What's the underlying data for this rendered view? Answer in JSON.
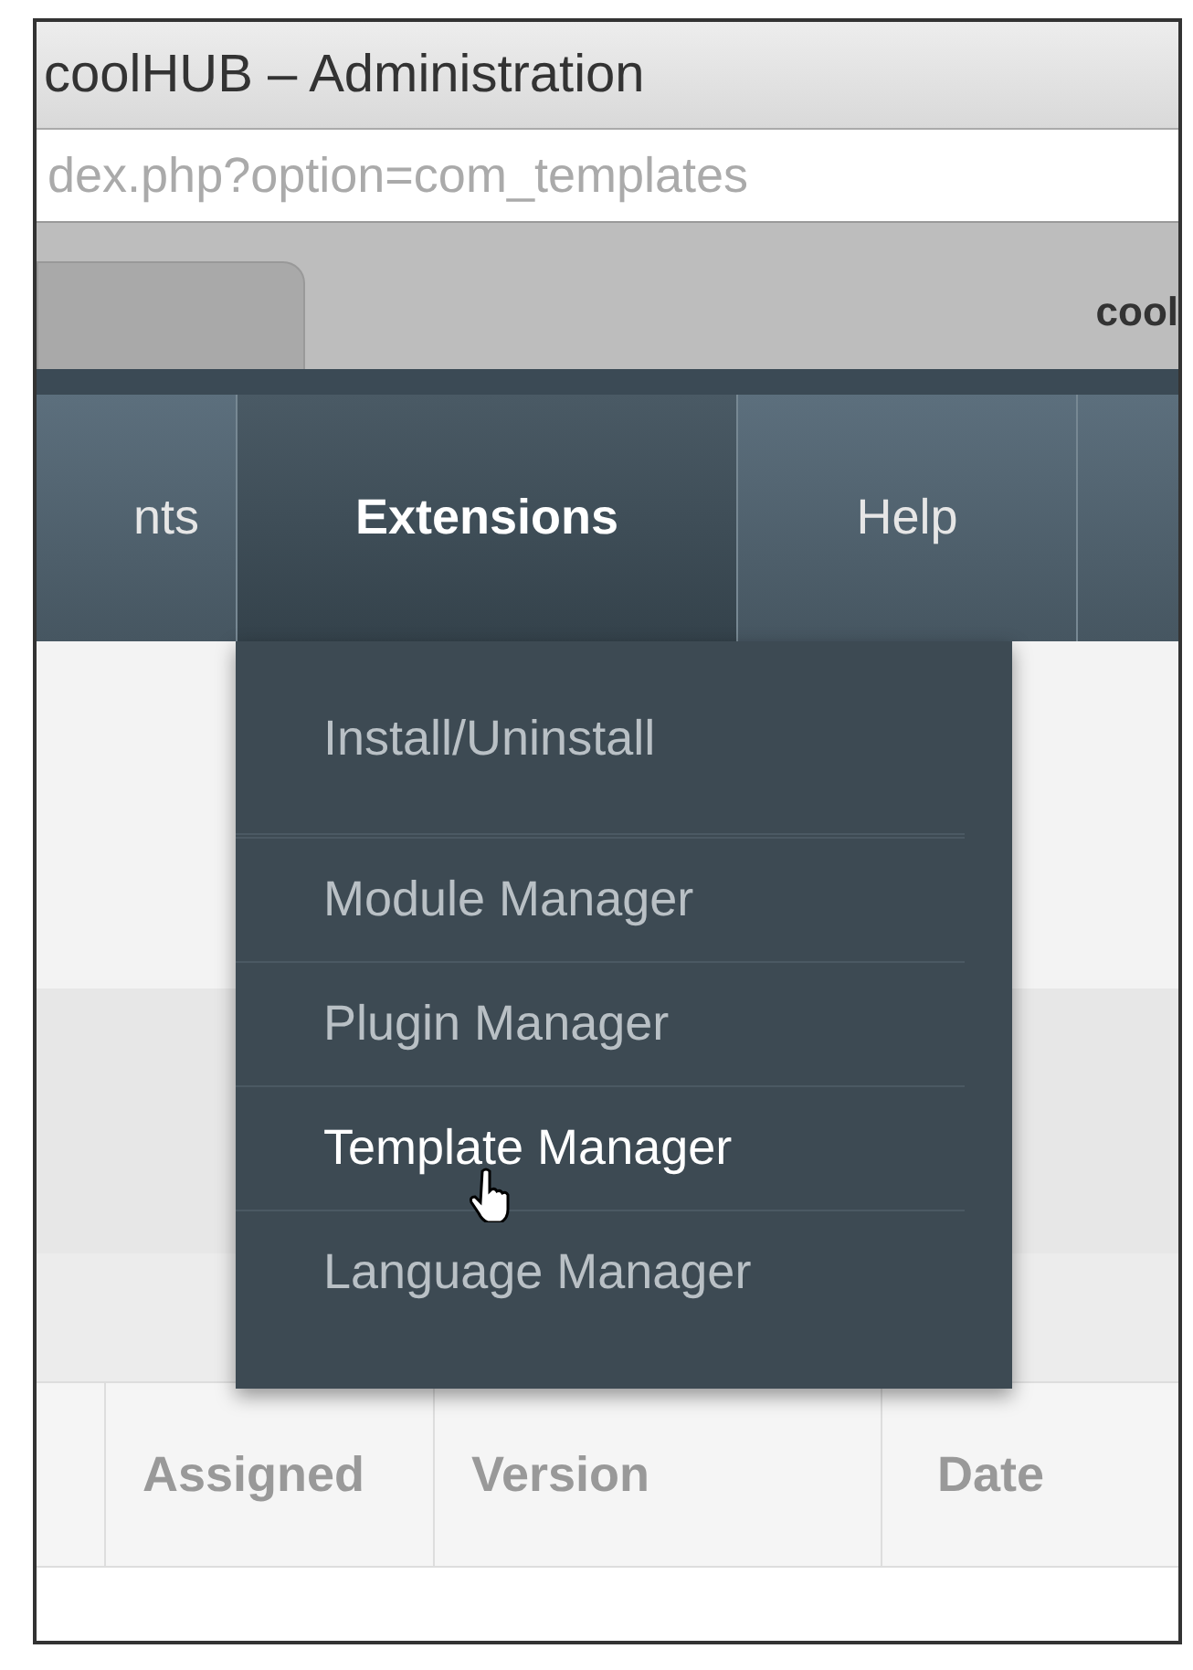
{
  "window": {
    "title": "coolHUB – Administration"
  },
  "address_bar": {
    "url": "dex.php?option=com_templates"
  },
  "browser_tab": {
    "label": "cool"
  },
  "nav": [
    {
      "label": "nts",
      "selected": false
    },
    {
      "label": "Extensions",
      "selected": true
    },
    {
      "label": "Help",
      "selected": false
    }
  ],
  "menu": [
    {
      "label": "Install/Uninstall",
      "hovered": false
    },
    {
      "label": "Module Manager",
      "hovered": false
    },
    {
      "label": "Plugin Manager",
      "hovered": false
    },
    {
      "label": "Template Manager",
      "hovered": true
    },
    {
      "label": "Language Manager",
      "hovered": false
    }
  ],
  "table": {
    "columns": [
      "Assigned",
      "Version",
      "Date"
    ]
  }
}
